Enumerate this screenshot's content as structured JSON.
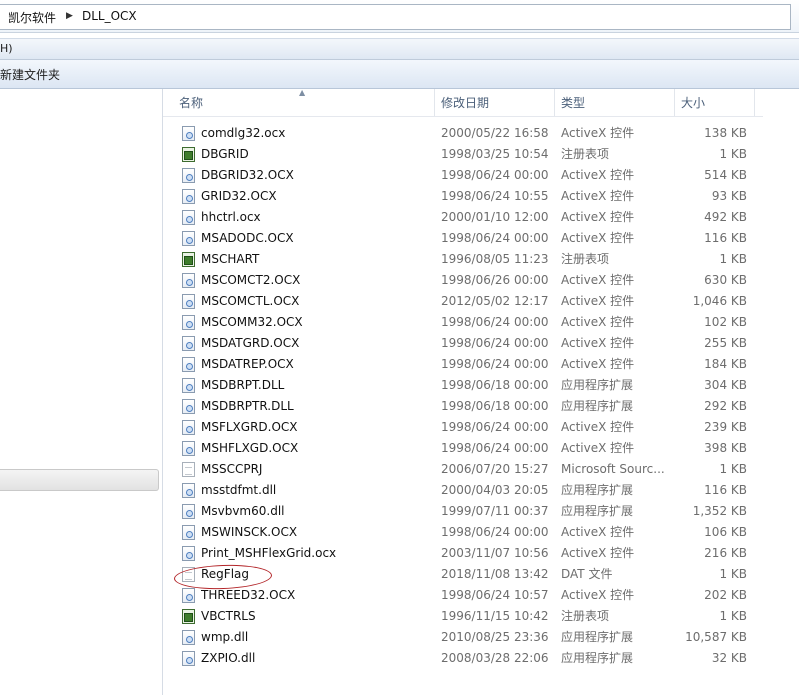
{
  "address_bar": {
    "crumbs": [
      "凯尔软件",
      "DLL_OCX"
    ]
  },
  "menu_bar": {
    "visible_text": "H)"
  },
  "toolbar": {
    "new_folder_label": "新建文件夹"
  },
  "columns": {
    "name": "名称",
    "date": "修改日期",
    "type": "类型",
    "size": "大小"
  },
  "files": [
    {
      "name": "comdlg32.ocx",
      "date": "2000/05/22 16:58",
      "type": "ActiveX 控件",
      "size": "138 KB",
      "icon": "dll"
    },
    {
      "name": "DBGRID",
      "date": "1998/03/25 10:54",
      "type": "注册表项",
      "size": "1 KB",
      "icon": "reg"
    },
    {
      "name": "DBGRID32.OCX",
      "date": "1998/06/24 00:00",
      "type": "ActiveX 控件",
      "size": "514 KB",
      "icon": "dll"
    },
    {
      "name": "GRID32.OCX",
      "date": "1998/06/24 10:55",
      "type": "ActiveX 控件",
      "size": "93 KB",
      "icon": "dll"
    },
    {
      "name": "hhctrl.ocx",
      "date": "2000/01/10 12:00",
      "type": "ActiveX 控件",
      "size": "492 KB",
      "icon": "dll"
    },
    {
      "name": "MSADODC.OCX",
      "date": "1998/06/24 00:00",
      "type": "ActiveX 控件",
      "size": "116 KB",
      "icon": "dll"
    },
    {
      "name": "MSCHART",
      "date": "1996/08/05 11:23",
      "type": "注册表项",
      "size": "1 KB",
      "icon": "reg"
    },
    {
      "name": "MSCOMCT2.OCX",
      "date": "1998/06/26 00:00",
      "type": "ActiveX 控件",
      "size": "630 KB",
      "icon": "dll"
    },
    {
      "name": "MSCOMCTL.OCX",
      "date": "2012/05/02 12:17",
      "type": "ActiveX 控件",
      "size": "1,046 KB",
      "icon": "dll"
    },
    {
      "name": "MSCOMM32.OCX",
      "date": "1998/06/24 00:00",
      "type": "ActiveX 控件",
      "size": "102 KB",
      "icon": "dll"
    },
    {
      "name": "MSDATGRD.OCX",
      "date": "1998/06/24 00:00",
      "type": "ActiveX 控件",
      "size": "255 KB",
      "icon": "dll"
    },
    {
      "name": "MSDATREP.OCX",
      "date": "1998/06/24 00:00",
      "type": "ActiveX 控件",
      "size": "184 KB",
      "icon": "dll"
    },
    {
      "name": "MSDBRPT.DLL",
      "date": "1998/06/18 00:00",
      "type": "应用程序扩展",
      "size": "304 KB",
      "icon": "dll"
    },
    {
      "name": "MSDBRPTR.DLL",
      "date": "1998/06/18 00:00",
      "type": "应用程序扩展",
      "size": "292 KB",
      "icon": "dll"
    },
    {
      "name": "MSFLXGRD.OCX",
      "date": "1998/06/24 00:00",
      "type": "ActiveX 控件",
      "size": "239 KB",
      "icon": "dll"
    },
    {
      "name": "MSHFLXGD.OCX",
      "date": "1998/06/24 00:00",
      "type": "ActiveX 控件",
      "size": "398 KB",
      "icon": "dll"
    },
    {
      "name": "MSSCCPRJ",
      "date": "2006/07/20 15:27",
      "type": "Microsoft Sourc...",
      "size": "1 KB",
      "icon": "doc"
    },
    {
      "name": "msstdfmt.dll",
      "date": "2000/04/03 20:05",
      "type": "应用程序扩展",
      "size": "116 KB",
      "icon": "dll"
    },
    {
      "name": "Msvbvm60.dll",
      "date": "1999/07/11 00:37",
      "type": "应用程序扩展",
      "size": "1,352 KB",
      "icon": "dll"
    },
    {
      "name": "MSWINSCK.OCX",
      "date": "1998/06/24 00:00",
      "type": "ActiveX 控件",
      "size": "106 KB",
      "icon": "dll"
    },
    {
      "name": "Print_MSHFlexGrid.ocx",
      "date": "2003/11/07 10:56",
      "type": "ActiveX 控件",
      "size": "216 KB",
      "icon": "dll"
    },
    {
      "name": "RegFlag",
      "date": "2018/11/08 13:42",
      "type": "DAT 文件",
      "size": "1 KB",
      "icon": "doc"
    },
    {
      "name": "THREED32.OCX",
      "date": "1998/06/24 10:57",
      "type": "ActiveX 控件",
      "size": "202 KB",
      "icon": "dll"
    },
    {
      "name": "VBCTRLS",
      "date": "1996/11/15 10:42",
      "type": "注册表项",
      "size": "1 KB",
      "icon": "reg"
    },
    {
      "name": "wmp.dll",
      "date": "2010/08/25 23:36",
      "type": "应用程序扩展",
      "size": "10,587 KB",
      "icon": "dll"
    },
    {
      "name": "ZXPIO.dll",
      "date": "2008/03/28 22:06",
      "type": "应用程序扩展",
      "size": "32 KB",
      "icon": "dll"
    }
  ]
}
